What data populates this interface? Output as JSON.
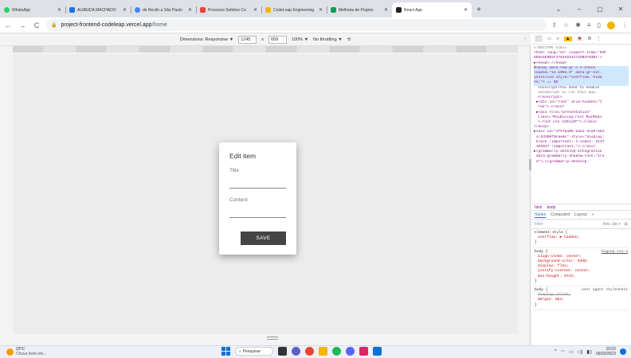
{
  "browser": {
    "tabs": [
      {
        "label": "WhatsApp",
        "color": "#25d366",
        "active": false
      },
      {
        "label": "ALMEIDA MACHADO",
        "color": "#1a73e8",
        "active": false
      },
      {
        "label": "de Recife a São Paulo",
        "color": "#4285f4",
        "active": false
      },
      {
        "label": "Processo Seletivo Co",
        "color": "#ea4335",
        "active": false
      },
      {
        "label": "CodeLeap Engineering",
        "color": "#f4b400",
        "active": false
      },
      {
        "label": "Melhoria de Projeto",
        "color": "#0f9d58",
        "active": false
      },
      {
        "label": "React App",
        "color": "#202124",
        "active": true
      }
    ],
    "new_tab": "+",
    "window_controls": {
      "dropdown": "⌄",
      "minimize": "–",
      "maximize": "▢",
      "close": "✕"
    },
    "address": {
      "domain": "project-frontend-codeleap.vercel.app",
      "path": "/home"
    }
  },
  "device_toolbar": {
    "dimensions_label": "Dimensions: Responsive ▼",
    "width": "1245",
    "times": "x",
    "height": "658",
    "zoom": "100% ▼",
    "throttle": "No throttling ▼",
    "kebab": "⋮"
  },
  "dialog": {
    "title": "Edit item",
    "fields": [
      {
        "label": "Title"
      },
      {
        "label": "Content"
      }
    ],
    "save_label": "SAVE"
  },
  "devtools": {
    "dom_lines": [
      "<!DOCTYPE html>",
      "<html lang=\"en\" coupert-item=\"04F",
      "8D9A4E9B2F3784AD24272DB1F03B1\">",
      "▶<head>…</head>",
      "▼<body data-new-gr-c-s-check-",
      "loaded=\"14.1094.0\" data-gr-ext-",
      "installed style=\"overflow: hidd",
      "en;\"> == $0",
      "<noscript>You need to enable",
      "JavaScript to run this app.",
      "</noscript>",
      "▶<div id=\"root\" aria-hidden=\"t",
      "rue\">…</div>",
      "▶<div role=\"presentation\"",
      "class=\"MuiDialog-root MuiModa",
      "l-root css-126xj0f\">…</div>",
      "</body>",
      "▶<div id=\"1f57ba05-ada1-4ca9-bb4",
      "d-b3300f0cae8c\" style=\"display:",
      "block !important; z-index: 2147",
      "483647 !important;\">…</div>",
      "▶<grammarly-desktop-integration",
      "data-grammarly-shadow-root=\"tru",
      "e\">…</grammarly-desktop-"
    ],
    "crumbs": [
      "html",
      "body"
    ],
    "styles_tabs": [
      "Styles",
      "Computed",
      "Layout",
      "»"
    ],
    "filter_placeholder": "Filter",
    "filter_tools": ":hov  .cls  +",
    "css_rules": [
      {
        "selector": "element.style {",
        "source": "",
        "props": [
          "overflow: ▶ hidden;"
        ]
      },
      {
        "selector": "body {",
        "source": "Signup.css:4",
        "props": [
          "align-items: center;",
          "background-color: #ddd;",
          "display: flex;",
          "justify-content: center;",
          "min-height: 97vh;"
        ]
      },
      {
        "selector": "body {",
        "source": "user agent stylesheet",
        "props": [
          "display: block;",
          "margin: 8px;"
        ]
      }
    ]
  },
  "taskbar": {
    "weather_temp": "23°C",
    "weather_desc": "Chuva forte em...",
    "search_label": "Pesquisar",
    "time": "10:02",
    "date": "06/02/2023"
  }
}
